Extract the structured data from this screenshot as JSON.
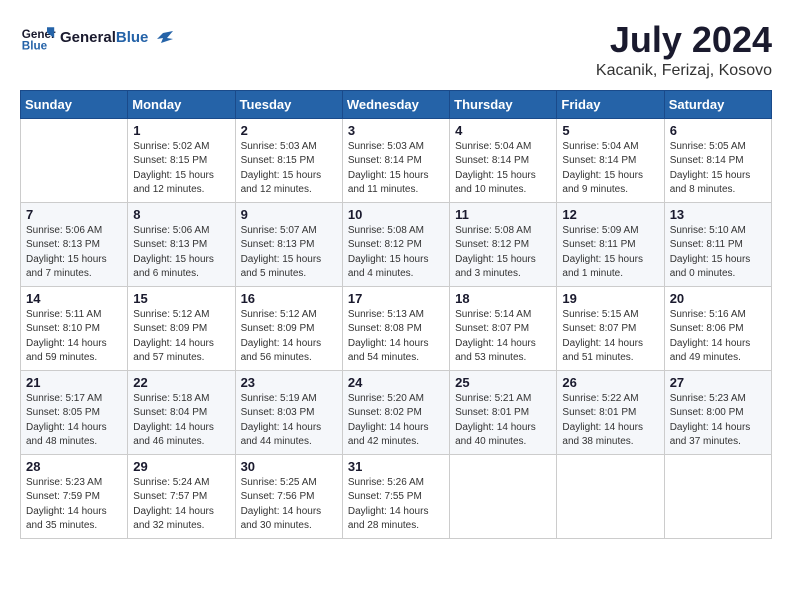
{
  "logo": {
    "text_general": "General",
    "text_blue": "Blue"
  },
  "title": "July 2024",
  "location": "Kacanik, Ferizaj, Kosovo",
  "days_of_week": [
    "Sunday",
    "Monday",
    "Tuesday",
    "Wednesday",
    "Thursday",
    "Friday",
    "Saturday"
  ],
  "weeks": [
    [
      {
        "day": "",
        "info": ""
      },
      {
        "day": "1",
        "info": "Sunrise: 5:02 AM\nSunset: 8:15 PM\nDaylight: 15 hours\nand 12 minutes."
      },
      {
        "day": "2",
        "info": "Sunrise: 5:03 AM\nSunset: 8:15 PM\nDaylight: 15 hours\nand 12 minutes."
      },
      {
        "day": "3",
        "info": "Sunrise: 5:03 AM\nSunset: 8:14 PM\nDaylight: 15 hours\nand 11 minutes."
      },
      {
        "day": "4",
        "info": "Sunrise: 5:04 AM\nSunset: 8:14 PM\nDaylight: 15 hours\nand 10 minutes."
      },
      {
        "day": "5",
        "info": "Sunrise: 5:04 AM\nSunset: 8:14 PM\nDaylight: 15 hours\nand 9 minutes."
      },
      {
        "day": "6",
        "info": "Sunrise: 5:05 AM\nSunset: 8:14 PM\nDaylight: 15 hours\nand 8 minutes."
      }
    ],
    [
      {
        "day": "7",
        "info": "Sunrise: 5:06 AM\nSunset: 8:13 PM\nDaylight: 15 hours\nand 7 minutes."
      },
      {
        "day": "8",
        "info": "Sunrise: 5:06 AM\nSunset: 8:13 PM\nDaylight: 15 hours\nand 6 minutes."
      },
      {
        "day": "9",
        "info": "Sunrise: 5:07 AM\nSunset: 8:13 PM\nDaylight: 15 hours\nand 5 minutes."
      },
      {
        "day": "10",
        "info": "Sunrise: 5:08 AM\nSunset: 8:12 PM\nDaylight: 15 hours\nand 4 minutes."
      },
      {
        "day": "11",
        "info": "Sunrise: 5:08 AM\nSunset: 8:12 PM\nDaylight: 15 hours\nand 3 minutes."
      },
      {
        "day": "12",
        "info": "Sunrise: 5:09 AM\nSunset: 8:11 PM\nDaylight: 15 hours\nand 1 minute."
      },
      {
        "day": "13",
        "info": "Sunrise: 5:10 AM\nSunset: 8:11 PM\nDaylight: 15 hours\nand 0 minutes."
      }
    ],
    [
      {
        "day": "14",
        "info": "Sunrise: 5:11 AM\nSunset: 8:10 PM\nDaylight: 14 hours\nand 59 minutes."
      },
      {
        "day": "15",
        "info": "Sunrise: 5:12 AM\nSunset: 8:09 PM\nDaylight: 14 hours\nand 57 minutes."
      },
      {
        "day": "16",
        "info": "Sunrise: 5:12 AM\nSunset: 8:09 PM\nDaylight: 14 hours\nand 56 minutes."
      },
      {
        "day": "17",
        "info": "Sunrise: 5:13 AM\nSunset: 8:08 PM\nDaylight: 14 hours\nand 54 minutes."
      },
      {
        "day": "18",
        "info": "Sunrise: 5:14 AM\nSunset: 8:07 PM\nDaylight: 14 hours\nand 53 minutes."
      },
      {
        "day": "19",
        "info": "Sunrise: 5:15 AM\nSunset: 8:07 PM\nDaylight: 14 hours\nand 51 minutes."
      },
      {
        "day": "20",
        "info": "Sunrise: 5:16 AM\nSunset: 8:06 PM\nDaylight: 14 hours\nand 49 minutes."
      }
    ],
    [
      {
        "day": "21",
        "info": "Sunrise: 5:17 AM\nSunset: 8:05 PM\nDaylight: 14 hours\nand 48 minutes."
      },
      {
        "day": "22",
        "info": "Sunrise: 5:18 AM\nSunset: 8:04 PM\nDaylight: 14 hours\nand 46 minutes."
      },
      {
        "day": "23",
        "info": "Sunrise: 5:19 AM\nSunset: 8:03 PM\nDaylight: 14 hours\nand 44 minutes."
      },
      {
        "day": "24",
        "info": "Sunrise: 5:20 AM\nSunset: 8:02 PM\nDaylight: 14 hours\nand 42 minutes."
      },
      {
        "day": "25",
        "info": "Sunrise: 5:21 AM\nSunset: 8:01 PM\nDaylight: 14 hours\nand 40 minutes."
      },
      {
        "day": "26",
        "info": "Sunrise: 5:22 AM\nSunset: 8:01 PM\nDaylight: 14 hours\nand 38 minutes."
      },
      {
        "day": "27",
        "info": "Sunrise: 5:23 AM\nSunset: 8:00 PM\nDaylight: 14 hours\nand 37 minutes."
      }
    ],
    [
      {
        "day": "28",
        "info": "Sunrise: 5:23 AM\nSunset: 7:59 PM\nDaylight: 14 hours\nand 35 minutes."
      },
      {
        "day": "29",
        "info": "Sunrise: 5:24 AM\nSunset: 7:57 PM\nDaylight: 14 hours\nand 32 minutes."
      },
      {
        "day": "30",
        "info": "Sunrise: 5:25 AM\nSunset: 7:56 PM\nDaylight: 14 hours\nand 30 minutes."
      },
      {
        "day": "31",
        "info": "Sunrise: 5:26 AM\nSunset: 7:55 PM\nDaylight: 14 hours\nand 28 minutes."
      },
      {
        "day": "",
        "info": ""
      },
      {
        "day": "",
        "info": ""
      },
      {
        "day": "",
        "info": ""
      }
    ]
  ]
}
